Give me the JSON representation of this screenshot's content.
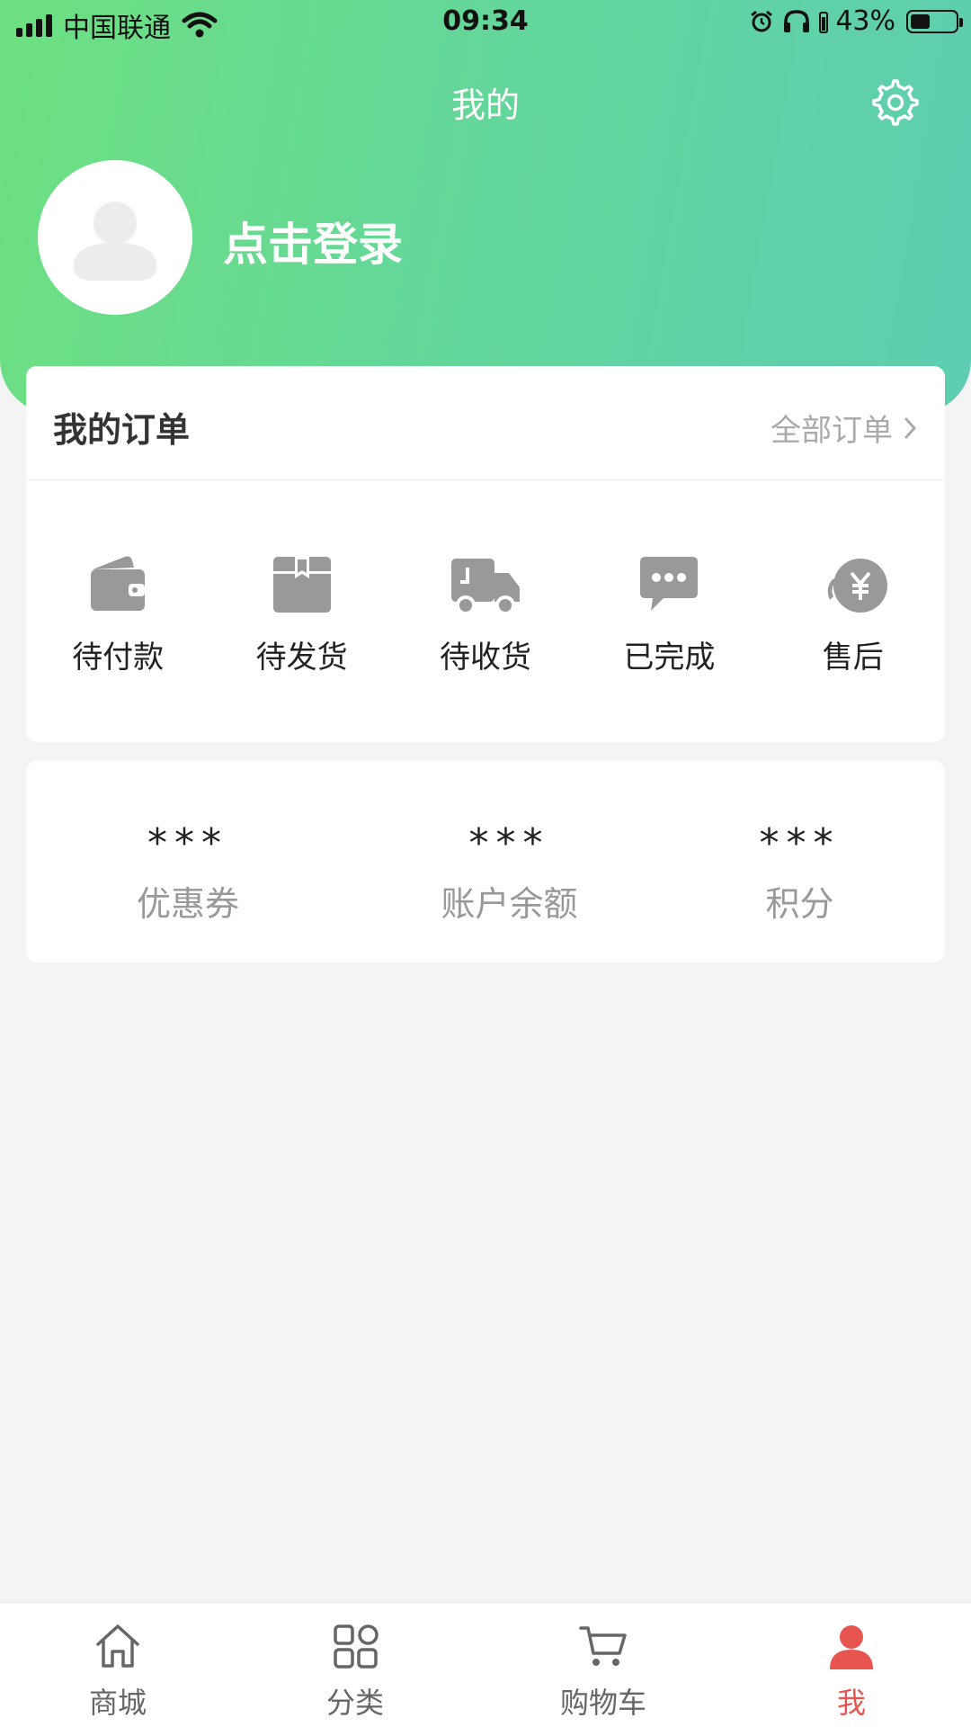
{
  "status_bar": {
    "carrier": "中国联通",
    "time": "09:34",
    "battery": "43%",
    "battery_level": 0.43
  },
  "header": {
    "title": "我的",
    "login_text": "点击登录"
  },
  "orders": {
    "title": "我的订单",
    "all_label": "全部订单",
    "items": [
      {
        "label": "待付款",
        "icon": "wallet-icon"
      },
      {
        "label": "待发货",
        "icon": "box-icon"
      },
      {
        "label": "待收货",
        "icon": "truck-icon"
      },
      {
        "label": "已完成",
        "icon": "chat-bubble-icon"
      },
      {
        "label": "售后",
        "icon": "yen-coin-icon"
      }
    ]
  },
  "stats": [
    {
      "value": "***",
      "label": "优惠券"
    },
    {
      "value": "***",
      "label": "账户余额"
    },
    {
      "value": "***",
      "label": "积分"
    }
  ],
  "tabs": [
    {
      "label": "商城",
      "icon": "home-icon"
    },
    {
      "label": "分类",
      "icon": "category-icon"
    },
    {
      "label": "购物车",
      "icon": "cart-icon"
    },
    {
      "label": "我",
      "icon": "user-icon"
    }
  ],
  "colors": {
    "header_gradient_start": "#6ee081",
    "header_gradient_end": "#5ecdb2",
    "active_tab": "#e85550",
    "icon_gray": "#999999",
    "background": "#f4f4f4"
  }
}
